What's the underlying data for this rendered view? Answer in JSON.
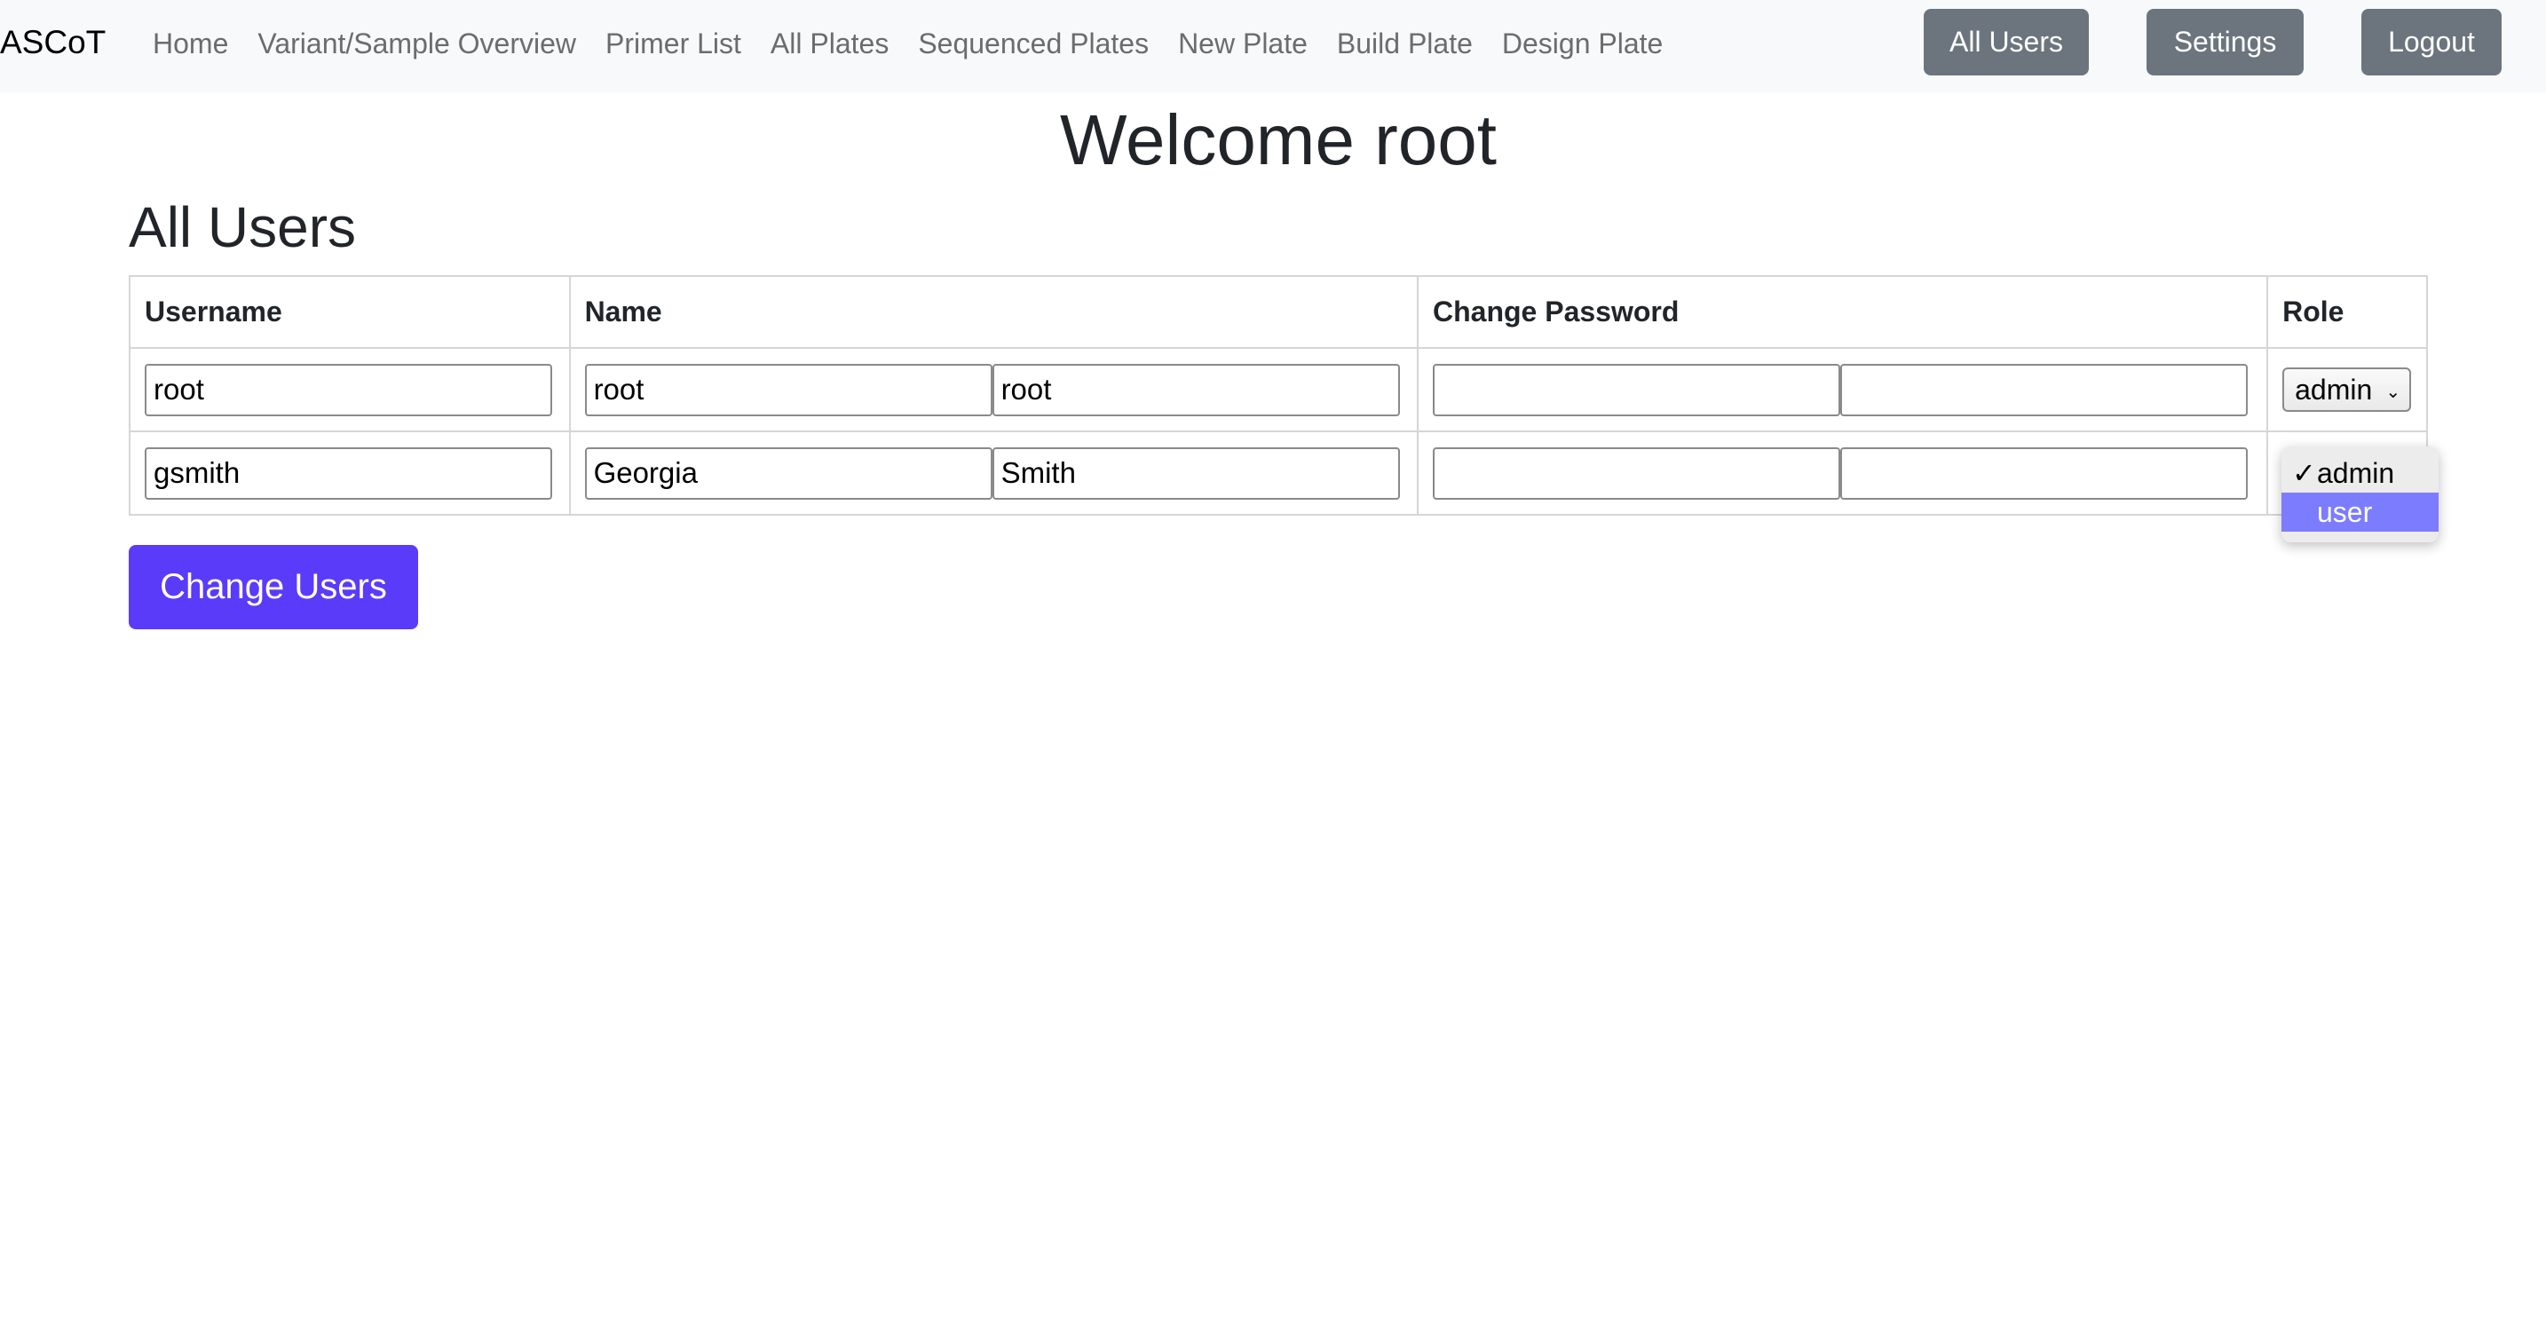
{
  "navbar": {
    "brand": "ASCoT",
    "links": [
      "Home",
      "Variant/Sample Overview",
      "Primer List",
      "All Plates",
      "Sequenced Plates",
      "New Plate",
      "Build Plate",
      "Design Plate"
    ],
    "buttons": {
      "all_users": "All Users",
      "settings": "Settings",
      "logout": "Logout"
    }
  },
  "page": {
    "welcome": "Welcome root",
    "section_title": "All Users"
  },
  "table": {
    "headers": [
      "Username",
      "Name",
      "Change Password",
      "Role"
    ],
    "rows": [
      {
        "username": "root",
        "first_name": "root",
        "last_name": "root",
        "password": "",
        "password_confirm": "",
        "role": "admin"
      },
      {
        "username": "gsmith",
        "first_name": "Georgia",
        "last_name": "Smith",
        "password": "",
        "password_confirm": "",
        "role": "user"
      }
    ]
  },
  "role_dropdown": {
    "options": [
      "admin",
      "user"
    ],
    "checked": "admin",
    "highlighted": "user",
    "check_glyph": "✓"
  },
  "submit_label": "Change Users"
}
